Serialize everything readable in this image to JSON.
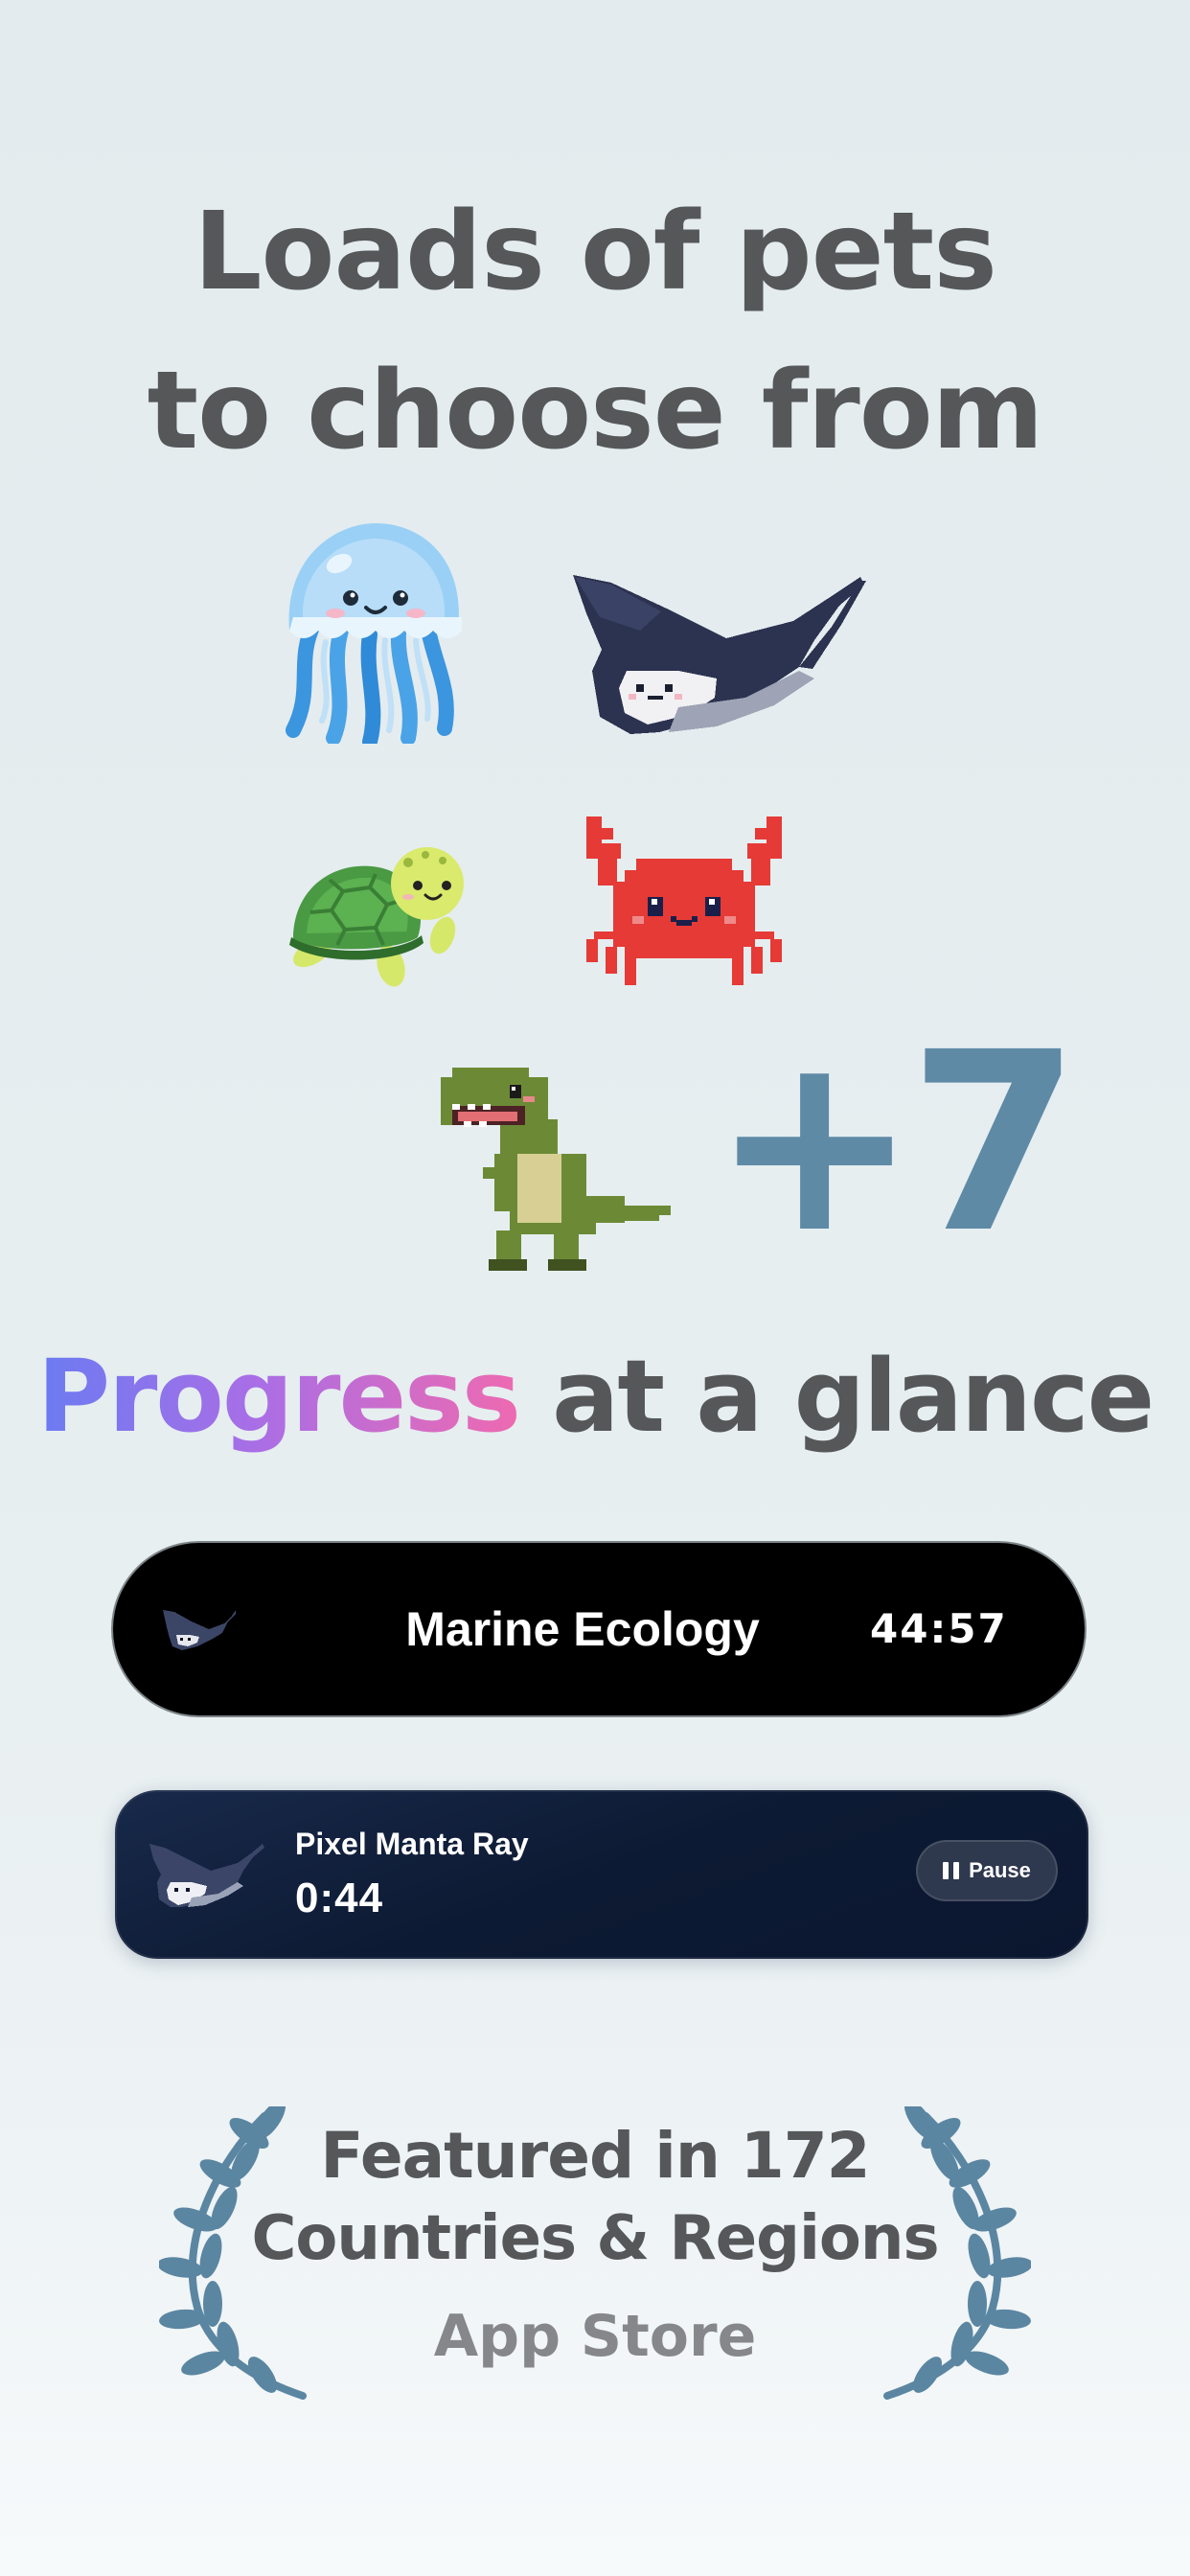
{
  "headline": {
    "line1": "Loads of pets",
    "line2": "to choose from"
  },
  "pets": [
    {
      "icon": "jellyfish-icon"
    },
    {
      "icon": "manta-ray-icon"
    },
    {
      "icon": "sea-turtle-icon"
    },
    {
      "icon": "crab-icon"
    },
    {
      "icon": "t-rex-icon"
    }
  ],
  "more_pets": "+7",
  "progress_heading": {
    "accent": "Progress",
    "rest": "at a glance"
  },
  "dynamic_island": {
    "title": "Marine Ecology",
    "timer": "44:57"
  },
  "live_activity": {
    "pet_name": "Pixel Manta Ray",
    "elapsed": "0:44",
    "pause_label": "Pause"
  },
  "award": {
    "line1": "Featured in 172",
    "line2": "Countries & Regions",
    "store": "App Store"
  },
  "colors": {
    "text": "#555759",
    "accent_gradient": [
      "#6b7bf2",
      "#a96ee6",
      "#ee6ab0"
    ],
    "plus_count": "#5f8aa6",
    "laurel": "#5b86a2",
    "activity_bg": "#0d1a33"
  }
}
